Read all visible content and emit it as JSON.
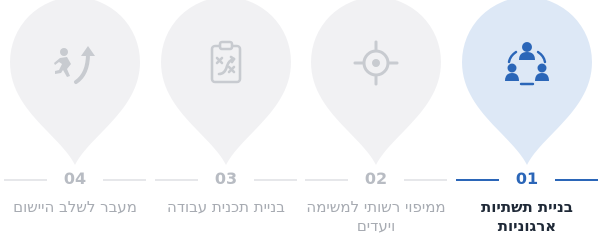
{
  "steps": [
    {
      "number": "01",
      "label": "בניית תשתיות ארגוניות",
      "icon": "team-structure-icon",
      "active": true
    },
    {
      "number": "02",
      "label": "ממיפוי רשותי למשימה ויעדים",
      "icon": "target-crosshair-icon",
      "active": false
    },
    {
      "number": "03",
      "label": "בניית תכנית עבודה",
      "icon": "strategy-clipboard-icon",
      "active": false
    },
    {
      "number": "04",
      "label": "מעבר לשלב היישום",
      "icon": "runner-arrow-icon",
      "active": false
    }
  ],
  "colors": {
    "active_pin": "#dde8f6",
    "active_icon": "#2b66b8",
    "inactive_pin": "#f1f1f3",
    "inactive_icon": "#c8cbd0",
    "active_text": "#1f2937",
    "inactive_text": "#a7abb2"
  }
}
